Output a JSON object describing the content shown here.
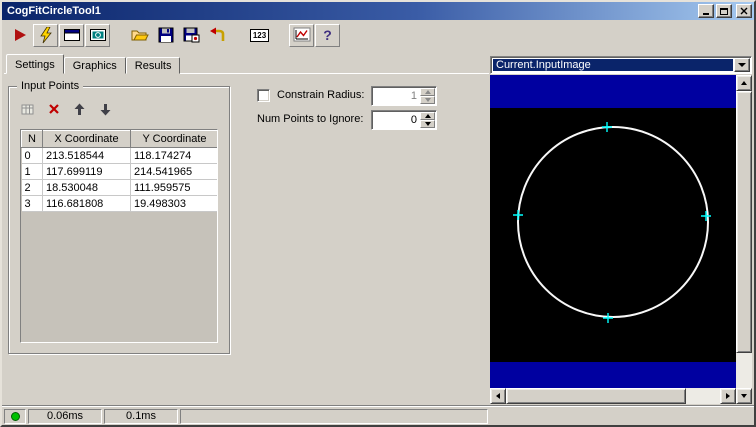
{
  "window": {
    "title": "CogFitCircleTool1"
  },
  "toolbar": {
    "numeric_label": "123",
    "help_label": "?"
  },
  "tabs": [
    {
      "label": "Settings",
      "active": true
    },
    {
      "label": "Graphics",
      "active": false
    },
    {
      "label": "Results",
      "active": false
    }
  ],
  "input_points": {
    "group_label": "Input Points",
    "columns": [
      "N",
      "X Coordinate",
      "Y Coordinate"
    ],
    "rows": [
      [
        "0",
        "213.518544",
        "118.174274"
      ],
      [
        "1",
        "117.699119",
        "214.541965"
      ],
      [
        "2",
        "18.530048",
        "111.959575"
      ],
      [
        "3",
        "116.681808",
        "19.498303"
      ]
    ]
  },
  "parameters": {
    "constrain_radius": {
      "label": "Constrain Radius:",
      "value": "1",
      "checked": false,
      "enabled": false
    },
    "num_points_to_ignore": {
      "label": "Num Points to Ignore:",
      "value": "0"
    }
  },
  "image_panel": {
    "source_selected": "Current.InputImage"
  },
  "status_bar": {
    "timer1": "0.06ms",
    "timer2": "0.1ms"
  },
  "colors": {
    "face": "#D4D0C8",
    "title_gradient_start": "#0A246A",
    "title_gradient_end": "#A6CAF0",
    "selection_highlight": "#0A246A",
    "image_band_blue": "#0000A0",
    "circle_stroke": "#F8F8F8",
    "marker_cyan": "#00FFFF",
    "status_led_green": "#00C000"
  }
}
